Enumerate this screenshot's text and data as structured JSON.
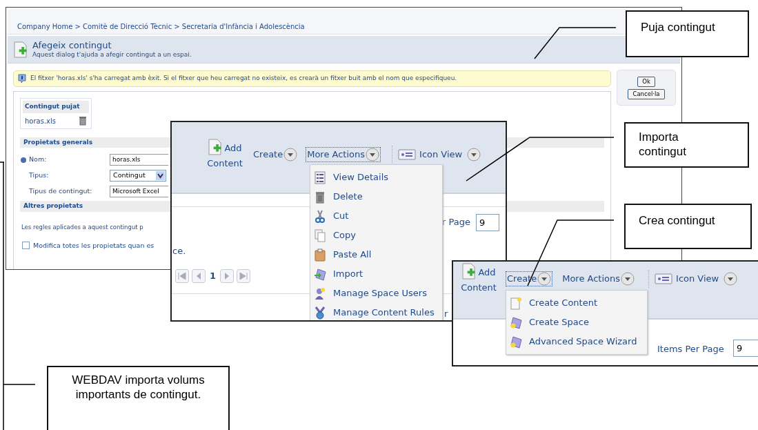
{
  "dialog": {
    "breadcrumb": "Company Home > Comitè de Direcció Tècnic > Secretaria d'Infància i Adolescència",
    "title": "Afegeix contingut",
    "subtitle": "Aquest dialog t'ajuda a afegir contingut a un espai.",
    "message": "El fitxer 'horas.xls' s'ha carregat amb èxit. Si el fitxer que heu carregat no existeix, es crearà un fitxer buit amb el nom que especifiqueu.",
    "buttons": [
      "Ok",
      "Cancel·la"
    ],
    "uploaded": {
      "heading": "Contingut pujat",
      "file": "horas.xls"
    },
    "general": {
      "heading": "Propietats generals",
      "fields": [
        {
          "label": "Nom:",
          "value": "horas.xls",
          "kind": "text",
          "required": true
        },
        {
          "label": "Tipus:",
          "value": "Contingut",
          "kind": "select",
          "required": false
        },
        {
          "label": "Tipus de contingut:",
          "value": "Microsoft Excel",
          "kind": "text",
          "required": false
        }
      ]
    },
    "other": {
      "heading": "Altres propietats",
      "text": "Les regles aplicades a aquest contingut p",
      "checkbox": {
        "label": "Modifica totes les propietats quan es",
        "checked": false
      }
    }
  },
  "actions_panel": {
    "add_content": "Add Content",
    "buttons": [
      {
        "label": "Create",
        "expanded": false
      },
      {
        "label": "More Actions",
        "expanded": true
      },
      {
        "label": "Icon View",
        "expanded": false
      }
    ],
    "menu": [
      {
        "label": "View Details",
        "kind": "details"
      },
      {
        "label": "Delete",
        "kind": "delete"
      },
      {
        "label": "Cut",
        "kind": "cut"
      },
      {
        "label": "Copy",
        "kind": "copy"
      },
      {
        "label": "Paste All",
        "kind": "paste"
      },
      {
        "label": "Import",
        "kind": "import"
      },
      {
        "label": "Manage Space Users",
        "kind": "users"
      },
      {
        "label": "Manage Content Rules",
        "kind": "rules"
      }
    ],
    "fragment_1": "ce.",
    "per_page_label": "r Page",
    "per_page": "9",
    "page": "1",
    "fragment_2": "r"
  },
  "create_panel": {
    "add_content": "Add Content",
    "buttons": [
      {
        "label": "Create",
        "expanded": true
      },
      {
        "label": "More Actions",
        "expanded": false
      },
      {
        "label": "Icon View",
        "expanded": false
      }
    ],
    "menu": [
      {
        "label": "Create Content",
        "kind": "new-content"
      },
      {
        "label": "Create Space",
        "kind": "new-space"
      },
      {
        "label": "Advanced Space Wizard",
        "kind": "new-space"
      }
    ],
    "per_page_label": "Items Per Page",
    "per_page": "9"
  },
  "callouts": [
    {
      "text": "Puja contingut"
    },
    {
      "text": "Importa contingut"
    },
    {
      "text": "Crea contingut"
    },
    {
      "text": "WEBDAV importa volums importants de contingut."
    }
  ]
}
